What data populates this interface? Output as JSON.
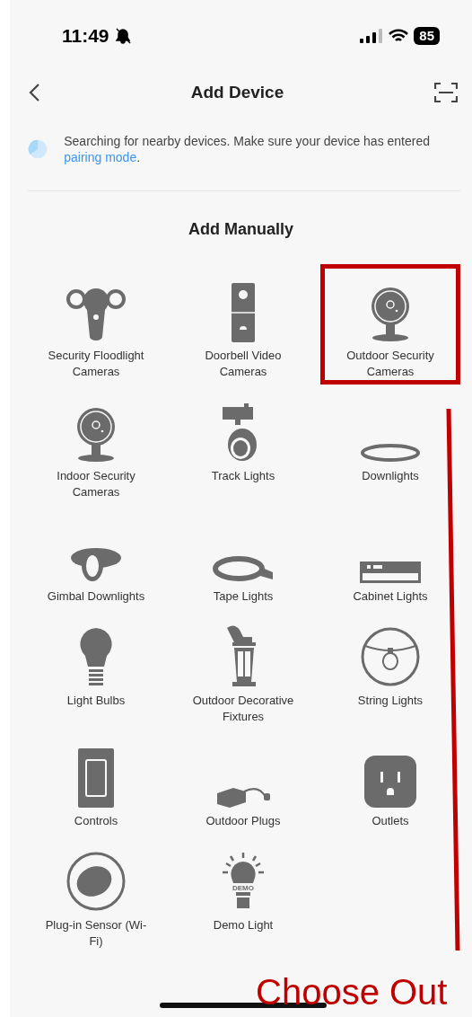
{
  "status_bar": {
    "time": "11:49",
    "battery": "85"
  },
  "header": {
    "title": "Add Device"
  },
  "search_notice": {
    "text": "Searching for nearby devices. Make sure your device has entered ",
    "link": "pairing mode",
    "suffix": "."
  },
  "section": {
    "title": "Add Manually"
  },
  "devices": [
    {
      "label": "Security Floodlight Cameras",
      "highlighted": false
    },
    {
      "label": "Doorbell Video Cameras",
      "highlighted": false
    },
    {
      "label": "Outdoor Security Cameras",
      "highlighted": true
    },
    {
      "label": "Indoor Security Cameras",
      "highlighted": false
    },
    {
      "label": "Track Lights",
      "highlighted": false
    },
    {
      "label": "Downlights",
      "highlighted": false
    },
    {
      "label": "Gimbal Downlights",
      "highlighted": false
    },
    {
      "label": "Tape Lights",
      "highlighted": false
    },
    {
      "label": "Cabinet Lights",
      "highlighted": false
    },
    {
      "label": "Light Bulbs",
      "highlighted": false
    },
    {
      "label": "Outdoor Decorative Fixtures",
      "highlighted": false
    },
    {
      "label": "String Lights",
      "highlighted": false
    },
    {
      "label": "Controls",
      "highlighted": false
    },
    {
      "label": "Outdoor Plugs",
      "highlighted": false
    },
    {
      "label": "Outlets",
      "highlighted": false
    },
    {
      "label": "Plug-in Sensor (Wi-Fi)",
      "highlighted": false
    },
    {
      "label": "Demo Light",
      "highlighted": false
    }
  ],
  "demo_icon": {
    "text": "DEMO"
  },
  "annotation": {
    "text": "Choose Out"
  }
}
